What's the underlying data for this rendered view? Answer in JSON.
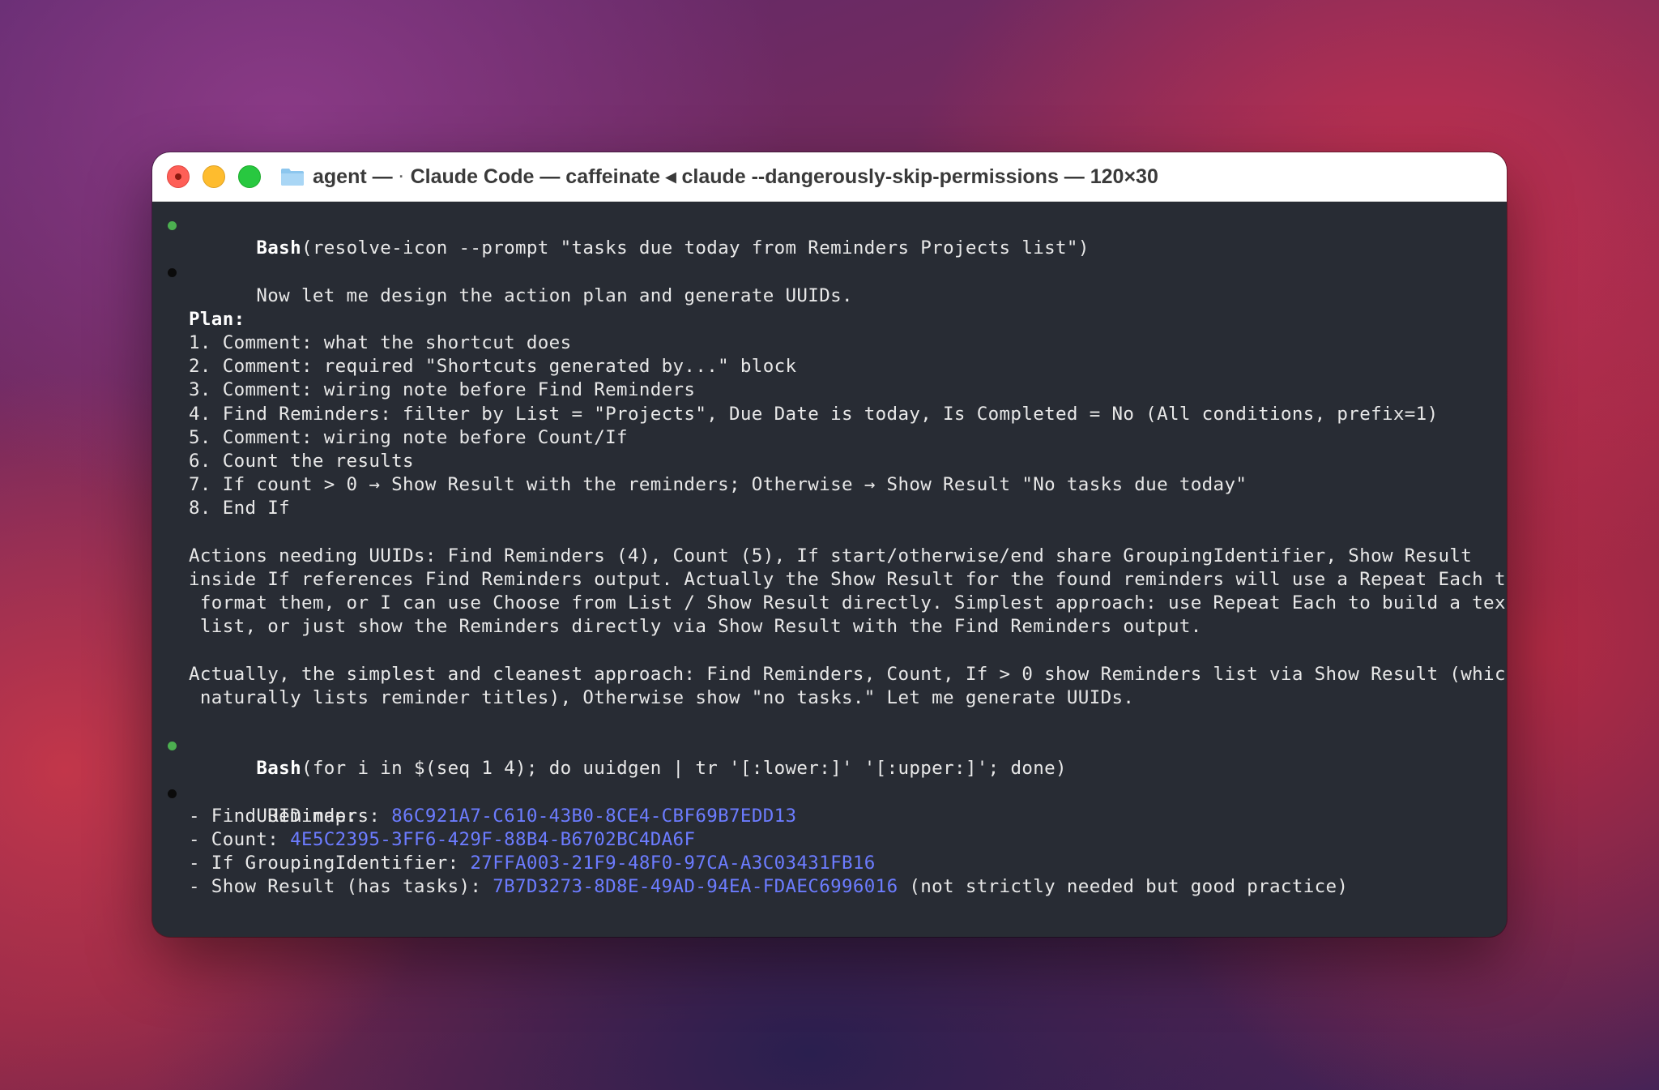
{
  "window": {
    "title_left": "agent —",
    "title_sep": "·",
    "title_main": "Claude Code — caffeinate ◂ claude --dangerously-skip-permissions — 120×30"
  },
  "terminal": {
    "bash1_cmd": "Bash",
    "bash1_args": "(resolve-icon --prompt \"tasks due today from Reminders Projects list\")",
    "intro": "Now let me design the action plan and generate UUIDs.",
    "plan_heading": "Plan:",
    "plan": [
      "1. Comment: what the shortcut does",
      "2. Comment: required \"Shortcuts generated by...\" block",
      "3. Comment: wiring note before Find Reminders",
      "4. Find Reminders: filter by List = \"Projects\", Due Date is today, Is Completed = No (All conditions, prefix=1)",
      "5. Comment: wiring note before Count/If",
      "6. Count the results",
      "7. If count > 0 → Show Result with the reminders; Otherwise → Show Result \"No tasks due today\"",
      "8. End If"
    ],
    "para1": [
      "Actions needing UUIDs: Find Reminders (4), Count (5), If start/otherwise/end share GroupingIdentifier, Show Result",
      "inside If references Find Reminders output. Actually the Show Result for the found reminders will use a Repeat Each to",
      " format them, or I can use Choose from List / Show Result directly. Simplest approach: use Repeat Each to build a text",
      " list, or just show the Reminders directly via Show Result with the Find Reminders output."
    ],
    "para2": [
      "Actually, the simplest and cleanest approach: Find Reminders, Count, If > 0 show Reminders list via Show Result (which",
      " naturally lists reminder titles), Otherwise show \"no tasks.\" Let me generate UUIDs."
    ],
    "bash2_cmd": "Bash",
    "bash2_args": "(for i in $(seq 1 4); do uuidgen | tr '[:lower:]' '[:upper:]'; done)",
    "uuid_heading": "UUID map:",
    "uuid_map": [
      {
        "label": "- Find Reminders: ",
        "uuid": "86C921A7-C610-43B0-8CE4-CBF69B7EDD13",
        "note": ""
      },
      {
        "label": "- Count: ",
        "uuid": "4E5C2395-3FF6-429F-88B4-B6702BC4DA6F",
        "note": ""
      },
      {
        "label": "- If GroupingIdentifier: ",
        "uuid": "27FFA003-21F9-48F0-97CA-A3C03431FB16",
        "note": ""
      },
      {
        "label": "- Show Result (has tasks): ",
        "uuid": "7B7D3273-8D8E-49AD-94EA-FDAEC6996016",
        "note": " (not strictly needed but good practice)"
      }
    ]
  },
  "colors": {
    "uuid": "#6c7cff",
    "success_bullet": "#4caf50",
    "terminal_bg": "#282c34"
  }
}
